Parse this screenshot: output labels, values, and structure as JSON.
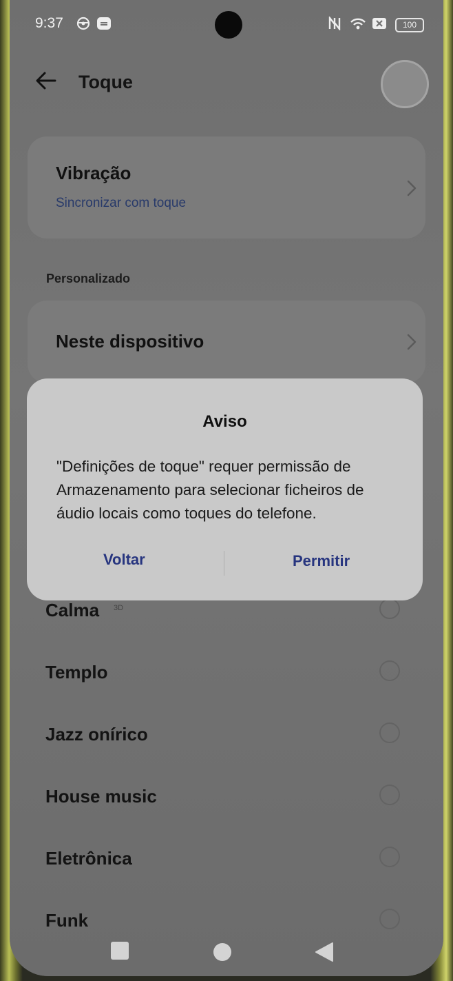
{
  "status_bar": {
    "time": "9:37",
    "battery": "100"
  },
  "header": {
    "title": "Toque"
  },
  "vibration": {
    "title": "Vibração",
    "subtitle": "Sincronizar com toque"
  },
  "custom_section": {
    "header": "Personalizado",
    "device_label": "Neste dispositivo"
  },
  "ringtones": [
    {
      "label": "Calma",
      "badge": "3D",
      "selected": false
    },
    {
      "label": "Templo",
      "selected": false
    },
    {
      "label": "Jazz onírico",
      "selected": false
    },
    {
      "label": "House music",
      "selected": false
    },
    {
      "label": "Eletrônica",
      "selected": false
    },
    {
      "label": "Funk",
      "selected": false
    }
  ],
  "dialog": {
    "title": "Aviso",
    "message": "\"Definições de toque\" requer permissão de Armazenamento para selecionar ficheiros de áudio locais como toques do telefone.",
    "cancel_label": "Voltar",
    "confirm_label": "Permitir"
  },
  "colors": {
    "accent": "#27357f",
    "dialog_background": "#c9c9c9",
    "scrim": "#727272"
  }
}
